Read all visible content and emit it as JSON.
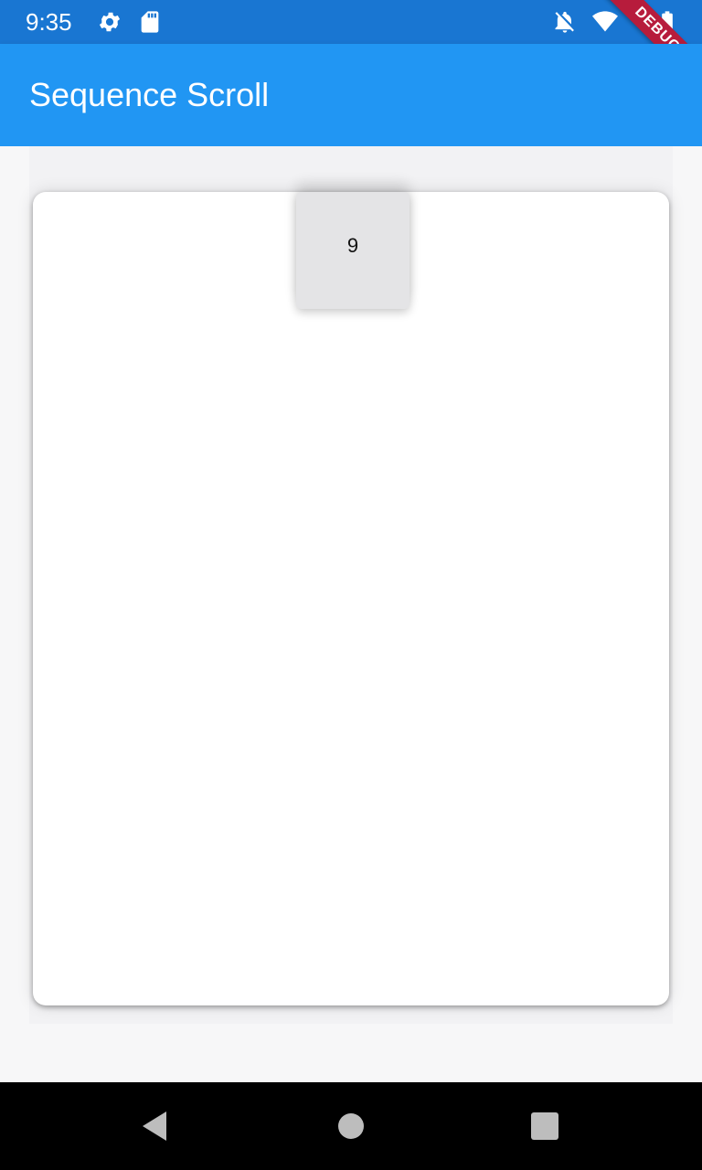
{
  "status_bar": {
    "time": "9:35",
    "icons": [
      "settings-icon",
      "sd-card-icon",
      "notifications-off-icon",
      "wifi-icon",
      "battery-icon"
    ]
  },
  "app_bar": {
    "title": "Sequence Scroll",
    "background": "#2196f3"
  },
  "debug_banner": {
    "label": "DEBUG",
    "color": "#b71c3c"
  },
  "list": {
    "visible_item_label": "9"
  },
  "nav_bar": {
    "buttons": [
      "back-icon",
      "home-icon",
      "recents-icon"
    ]
  }
}
